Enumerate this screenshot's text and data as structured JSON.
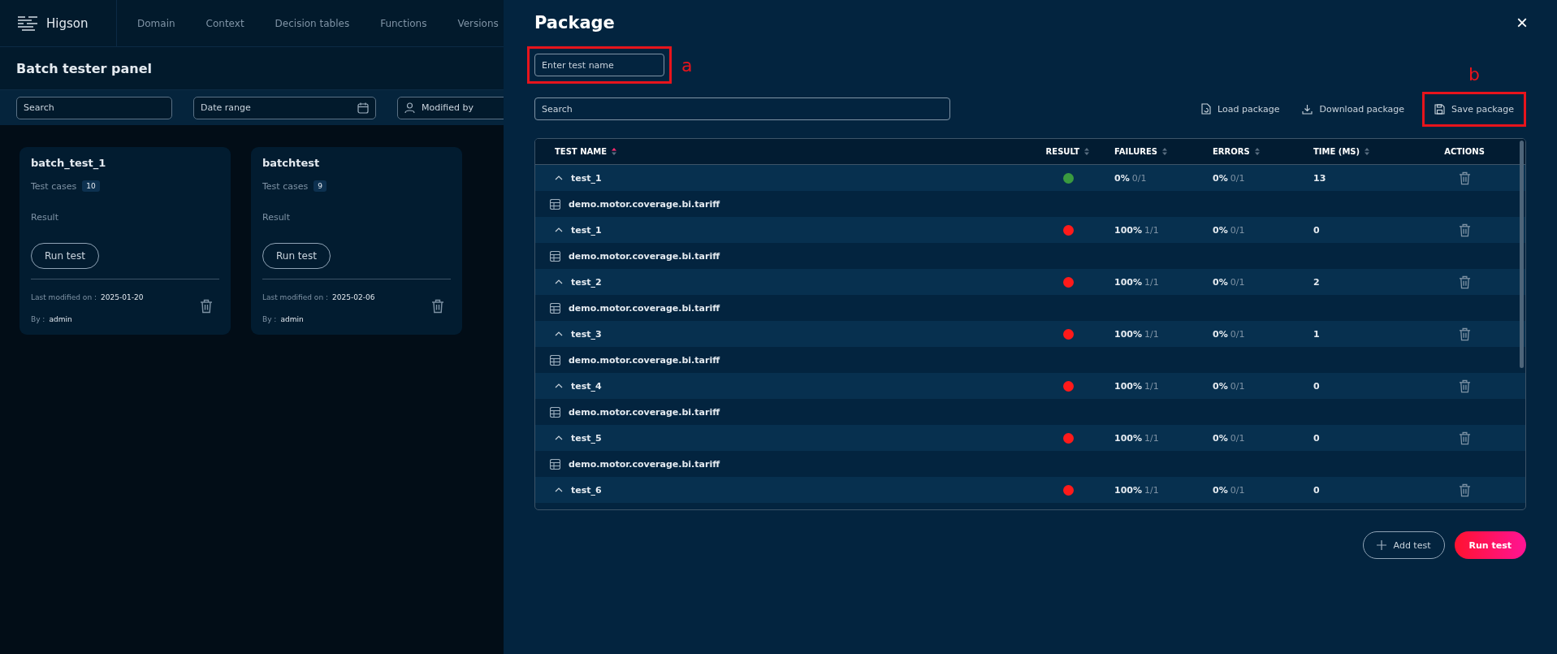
{
  "app": {
    "logo": "Higson",
    "nav": [
      {
        "label": "Domain"
      },
      {
        "label": "Context"
      },
      {
        "label": "Decision tables"
      },
      {
        "label": "Functions"
      },
      {
        "label": "Versions"
      }
    ],
    "page_title": "Batch tester panel",
    "filters": {
      "search_placeholder": "Search",
      "date_placeholder": "Date range",
      "user_placeholder": "Modified by"
    },
    "cards": [
      {
        "title": "batch_test_1",
        "cases_label": "Test cases",
        "cases": "10",
        "result_label": "Result",
        "button": "Run test",
        "modified_label": "Last modified on :",
        "modified": "2025-01-20",
        "by_label": "By :",
        "by": "admin"
      },
      {
        "title": "batchtest",
        "cases_label": "Test cases",
        "cases": "9",
        "result_label": "Result",
        "button": "Run test",
        "modified_label": "Last modified on :",
        "modified": "2025-02-06",
        "by_label": "By :",
        "by": "admin"
      }
    ]
  },
  "dialog": {
    "title": "Package",
    "close": "×",
    "name_field": {
      "placeholder": "Enter test name",
      "annotation": "a"
    },
    "search": {
      "placeholder": "Search"
    },
    "actions": [
      {
        "kind": "load",
        "label": "Load package"
      },
      {
        "kind": "download",
        "label": "Download package"
      },
      {
        "kind": "save",
        "label": "Save package",
        "annotation": "b"
      }
    ],
    "table": {
      "columns": [
        {
          "label": "TEST NAME",
          "sorted": true
        },
        {
          "label": "RESULT",
          "sorted": false
        },
        {
          "label": "FAILURES",
          "sorted": false
        },
        {
          "label": "ERRORS",
          "sorted": false
        },
        {
          "label": "TIME (MS)",
          "sorted": false
        },
        {
          "label": "ACTIONS"
        }
      ],
      "rows": [
        {
          "name": "test_1",
          "expanded": true,
          "color": "#3a9a3f",
          "failures": "0%",
          "failures_count": "0/1",
          "errors": "0%",
          "errors_count": "0/1",
          "time": "13",
          "children": [
            {
              "name": "demo.motor.coverage.bi.tariff"
            }
          ]
        },
        {
          "name": "test_1",
          "expanded": true,
          "color": "#ff1a1a",
          "failures": "100%",
          "failures_count": "1/1",
          "errors": "0%",
          "errors_count": "0/1",
          "time": "0",
          "children": [
            {
              "name": "demo.motor.coverage.bi.tariff"
            }
          ]
        },
        {
          "name": "test_2",
          "expanded": true,
          "color": "#ff1a1a",
          "failures": "100%",
          "failures_count": "1/1",
          "errors": "0%",
          "errors_count": "0/1",
          "time": "2",
          "children": [
            {
              "name": "demo.motor.coverage.bi.tariff"
            }
          ]
        },
        {
          "name": "test_3",
          "expanded": true,
          "color": "#ff1a1a",
          "failures": "100%",
          "failures_count": "1/1",
          "errors": "0%",
          "errors_count": "0/1",
          "time": "1",
          "children": [
            {
              "name": "demo.motor.coverage.bi.tariff"
            }
          ]
        },
        {
          "name": "test_4",
          "expanded": true,
          "color": "#ff1a1a",
          "failures": "100%",
          "failures_count": "1/1",
          "errors": "0%",
          "errors_count": "0/1",
          "time": "0",
          "children": [
            {
              "name": "demo.motor.coverage.bi.tariff"
            }
          ]
        },
        {
          "name": "test_5",
          "expanded": true,
          "color": "#ff1a1a",
          "failures": "100%",
          "failures_count": "1/1",
          "errors": "0%",
          "errors_count": "0/1",
          "time": "0",
          "children": [
            {
              "name": "demo.motor.coverage.bi.tariff"
            }
          ]
        },
        {
          "name": "test_6",
          "expanded": true,
          "color": "#ff1a1a",
          "failures": "100%",
          "failures_count": "1/1",
          "errors": "0%",
          "errors_count": "0/1",
          "time": "0"
        }
      ]
    },
    "footer": {
      "add": "Add test",
      "run": "Run test"
    }
  }
}
